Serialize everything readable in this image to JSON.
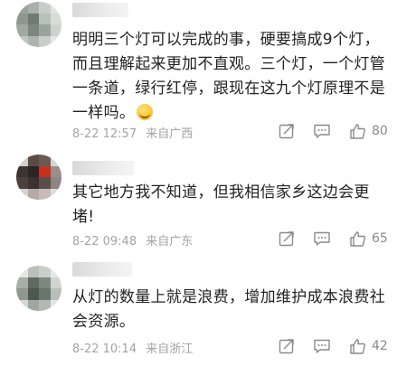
{
  "comments": [
    {
      "text": "明明三个灯可以完成的事，硬要搞成9个灯，而且理解起来更加不直观。三个灯，一个灯管一条道，绿行红停，跟现在这九个灯原理不是一样吗。",
      "emoji_icon": "laughing-emoji-icon",
      "time": "8-22 12:57",
      "source": "来自广西",
      "likes": "80"
    },
    {
      "text": "其它地方我不知道，但我相信家乡这边会更堵!",
      "time": "8-22 09:48",
      "source": "来自广东",
      "likes": "65"
    },
    {
      "text": "从灯的数量上就是浪费，增加维护成本浪费社会资源。",
      "time": "8-22 10:14",
      "source": "来自浙江",
      "likes": "42"
    }
  ],
  "icons": {
    "share": "share-icon",
    "reply": "comment-icon",
    "like": "thumbs-up-icon"
  },
  "colors": {
    "text": "#222222",
    "meta": "#a3a3a3",
    "icon": "#8a8a8a"
  }
}
